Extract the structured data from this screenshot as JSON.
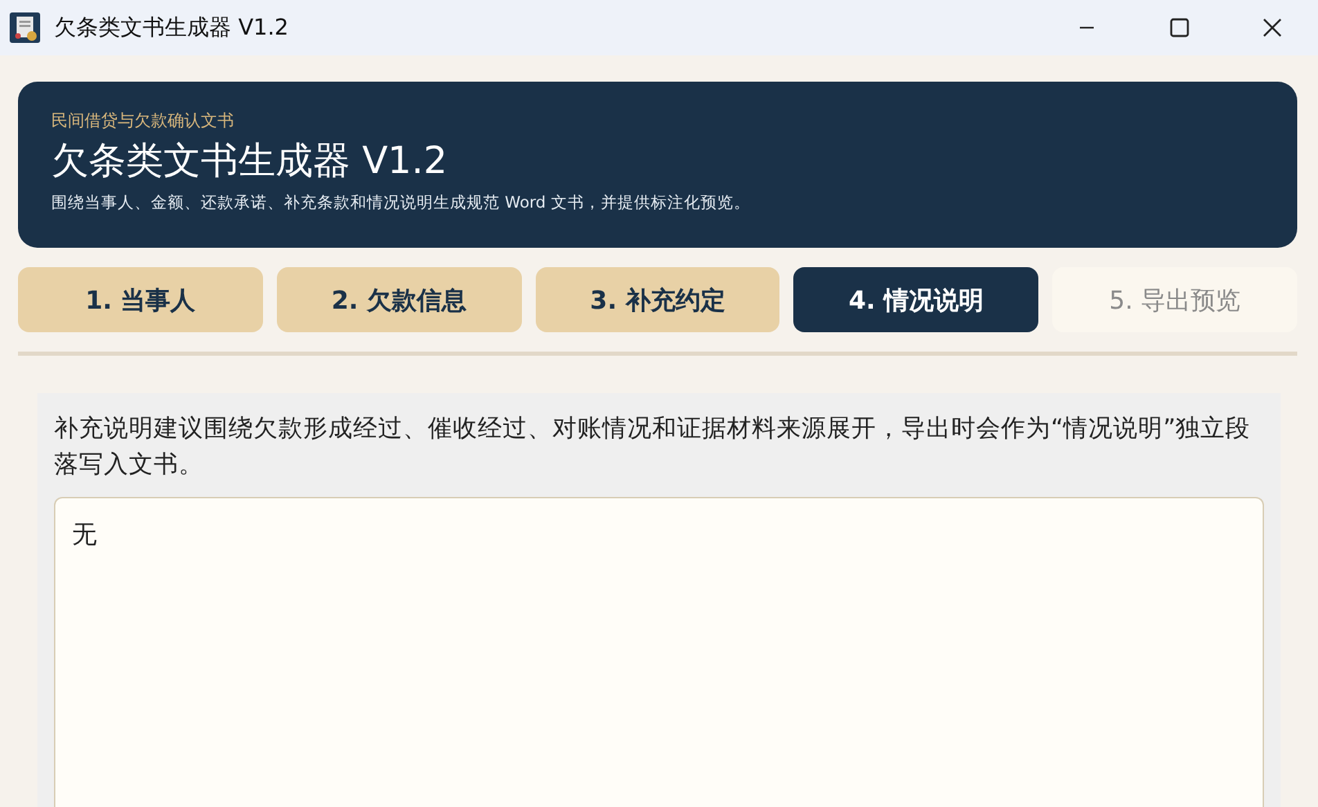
{
  "window": {
    "title": "欠条类文书生成器 V1.2"
  },
  "header": {
    "eyebrow": "民间借贷与欠款确认文书",
    "title": "欠条类文书生成器 V1.2",
    "subtitle": "围绕当事人、金额、还款承诺、补充条款和情况说明生成规范 Word 文书，并提供标注化预览。"
  },
  "tabs": [
    {
      "label": "1. 当事人",
      "selected": false,
      "disabled": false
    },
    {
      "label": "2. 欠款信息",
      "selected": false,
      "disabled": false
    },
    {
      "label": "3. 补充约定",
      "selected": false,
      "disabled": false
    },
    {
      "label": "4. 情况说明",
      "selected": true,
      "disabled": false
    },
    {
      "label": "5. 导出预览",
      "selected": false,
      "disabled": true
    }
  ],
  "panel": {
    "hint": "补充说明建议围绕欠款形成经过、催收经过、对账情况和证据材料来源展开，导出时会作为“情况说明”独立段落写入文书。",
    "textarea_value": "无"
  }
}
